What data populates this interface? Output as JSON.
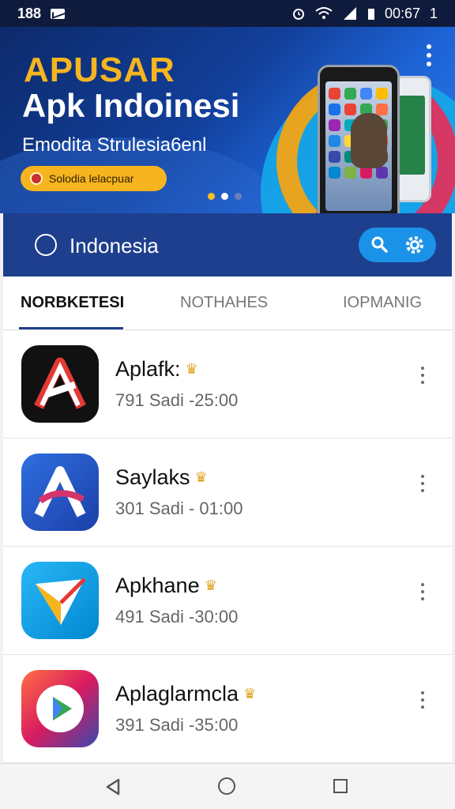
{
  "status_bar": {
    "time": "188",
    "clock": "00:67",
    "battery": "1"
  },
  "banner": {
    "title_line1": "APUSAR",
    "title_line2": "Apk Indoinesi",
    "subtitle": "Emodita Strulesia6enl",
    "button_label": "Solodia lelacpuar"
  },
  "search": {
    "value": "Indonesia"
  },
  "tabs": [
    {
      "label": "NORBKETESI",
      "active": true
    },
    {
      "label": "NOTHAHES",
      "active": false
    },
    {
      "label": "IOPMANIG",
      "active": false
    }
  ],
  "apps": [
    {
      "name": "Aplafk:",
      "meta": "791 Sadi -25:00",
      "icon": "letter-a-red-icon"
    },
    {
      "name": "Saylaks",
      "meta": "301 Sadi - 01:00",
      "icon": "letter-a-purple-icon"
    },
    {
      "name": "Apkhane",
      "meta": "491 Sadi -30:00",
      "icon": "paper-plane-icon"
    },
    {
      "name": "Aplaglarmcla",
      "meta": "391 Sadi -35:00",
      "icon": "play-triangle-icon"
    }
  ],
  "colors": {
    "accent": "#1e3f8e",
    "highlight": "#f6b51f",
    "pill": "#1a92e8"
  }
}
